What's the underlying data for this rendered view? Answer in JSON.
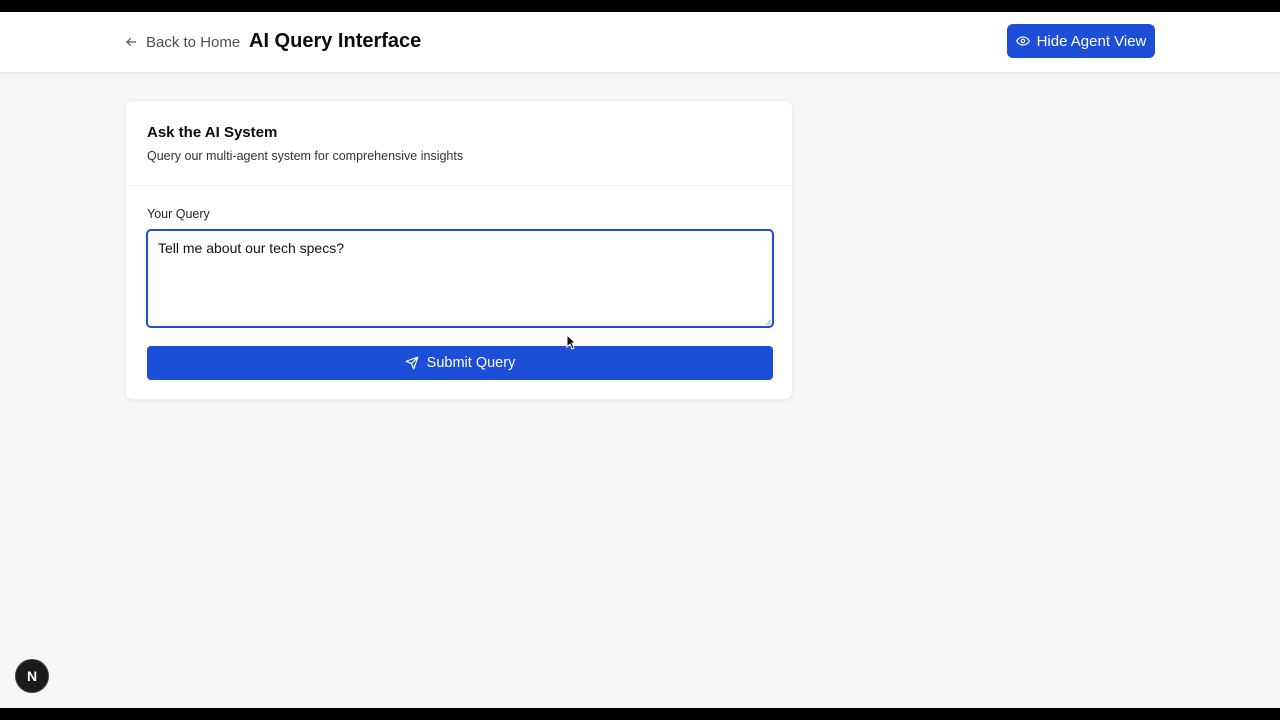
{
  "header": {
    "back_label": "Back to Home",
    "title": "AI Query Interface",
    "hide_agent_label": "Hide Agent View"
  },
  "card": {
    "title": "Ask the AI System",
    "subtitle": "Query our multi-agent system for comprehensive insights",
    "query_label": "Your Query",
    "query_value": "Tell me about our tech specs?",
    "submit_label": "Submit Query"
  },
  "badge": {
    "letter": "N"
  },
  "icons": {
    "back": "arrow-left-icon",
    "hide": "eye-icon",
    "submit": "send-icon"
  },
  "colors": {
    "accent": "#1d4ed8",
    "background": "#f5f7f8"
  }
}
